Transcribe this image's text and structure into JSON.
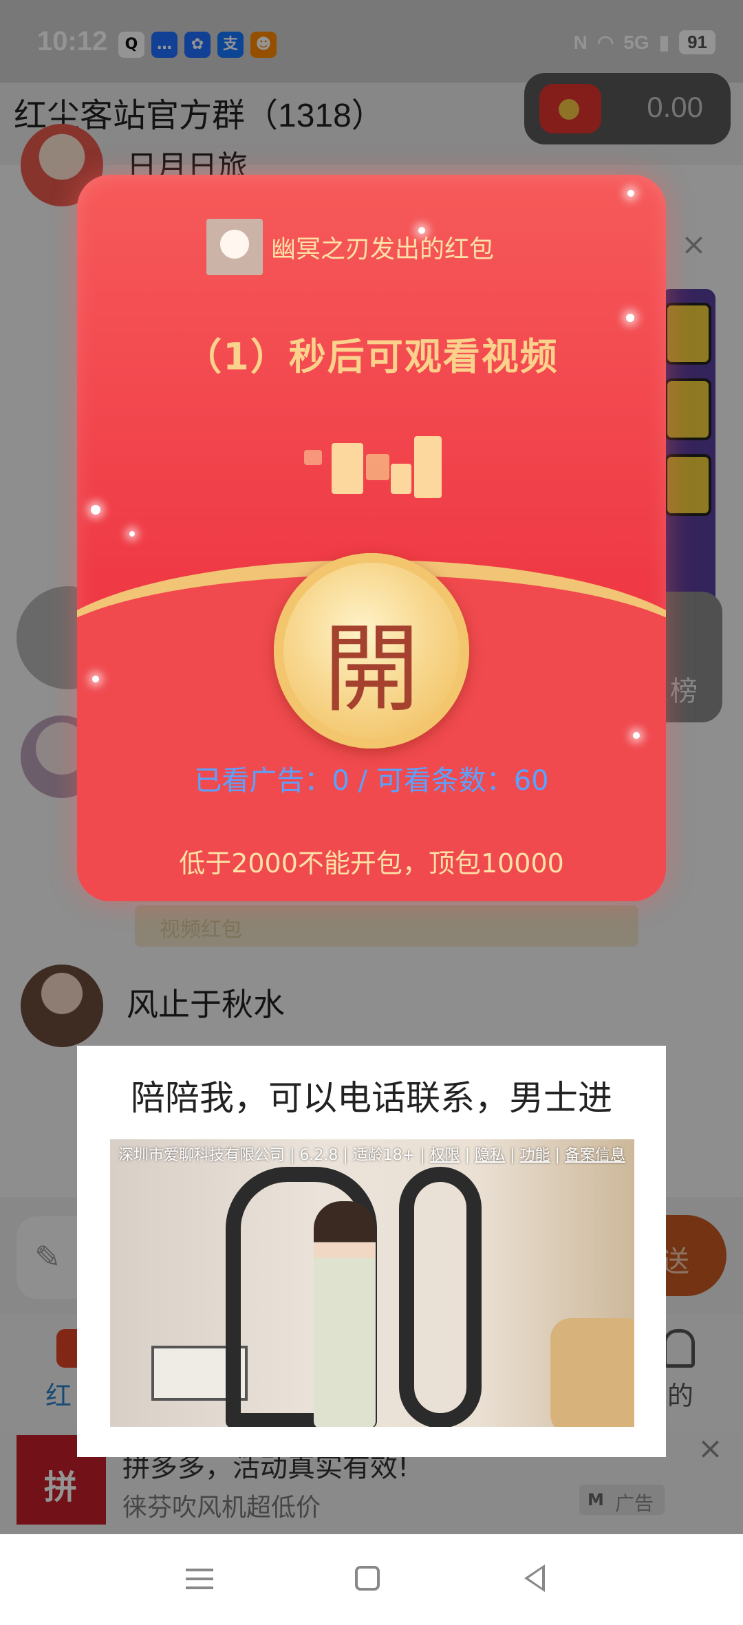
{
  "status_bar": {
    "time": "10:12",
    "notifications": [
      {
        "icon": "qq-icon",
        "glyph": "Q",
        "color": "#111111"
      },
      {
        "icon": "message-icon",
        "glyph": "…",
        "color": "#1f6fff"
      },
      {
        "icon": "pinwheel-icon",
        "glyph": "✿",
        "color": "#1f6fff"
      },
      {
        "icon": "alipay-icon",
        "glyph": "支",
        "color": "#1677ff"
      },
      {
        "icon": "app-icon",
        "glyph": "☻",
        "color": "#ff8a00"
      }
    ],
    "nfc": "N",
    "network": "5G",
    "battery": "91"
  },
  "header": {
    "title": "红尘客站官方群（1318）",
    "balance": "0.00"
  },
  "chat": {
    "top_sender": "日月日旅",
    "sender_name": "风止于秋水",
    "video_redpack_text": "视频红包",
    "rank_label": "榜"
  },
  "input": {
    "send_label": "送"
  },
  "tabs": {
    "left_label": "红",
    "right_label": "的"
  },
  "bottom_ad": {
    "title": "拼多多，活动真实有效!",
    "subtitle": "徕芬吹风机超低价",
    "tag": "广告",
    "tag_logo": "M"
  },
  "red_envelope": {
    "sender_text": "幽冥之刃发出的红包",
    "countdown_text": "（1）秒后可观看视频",
    "open_label": "開",
    "ad_counter_text": "已看广告：0  /  可看条数：60",
    "rule_text": "低于2000不能开包，顶包10000"
  },
  "ad_popup": {
    "title": "陪陪我，可以电话联系，男士进",
    "info_prefix": "深圳市爱聊科技有限公司 | 6.2.8 | 适龄18+ | ",
    "info_links": [
      "权限",
      "隐私",
      "功能",
      "备案信息"
    ]
  },
  "colors": {
    "envelope_red": "#ef3a45",
    "gold": "#f2c476",
    "counter_blue": "#5aa2ff",
    "send_orange": "#c95a24"
  }
}
